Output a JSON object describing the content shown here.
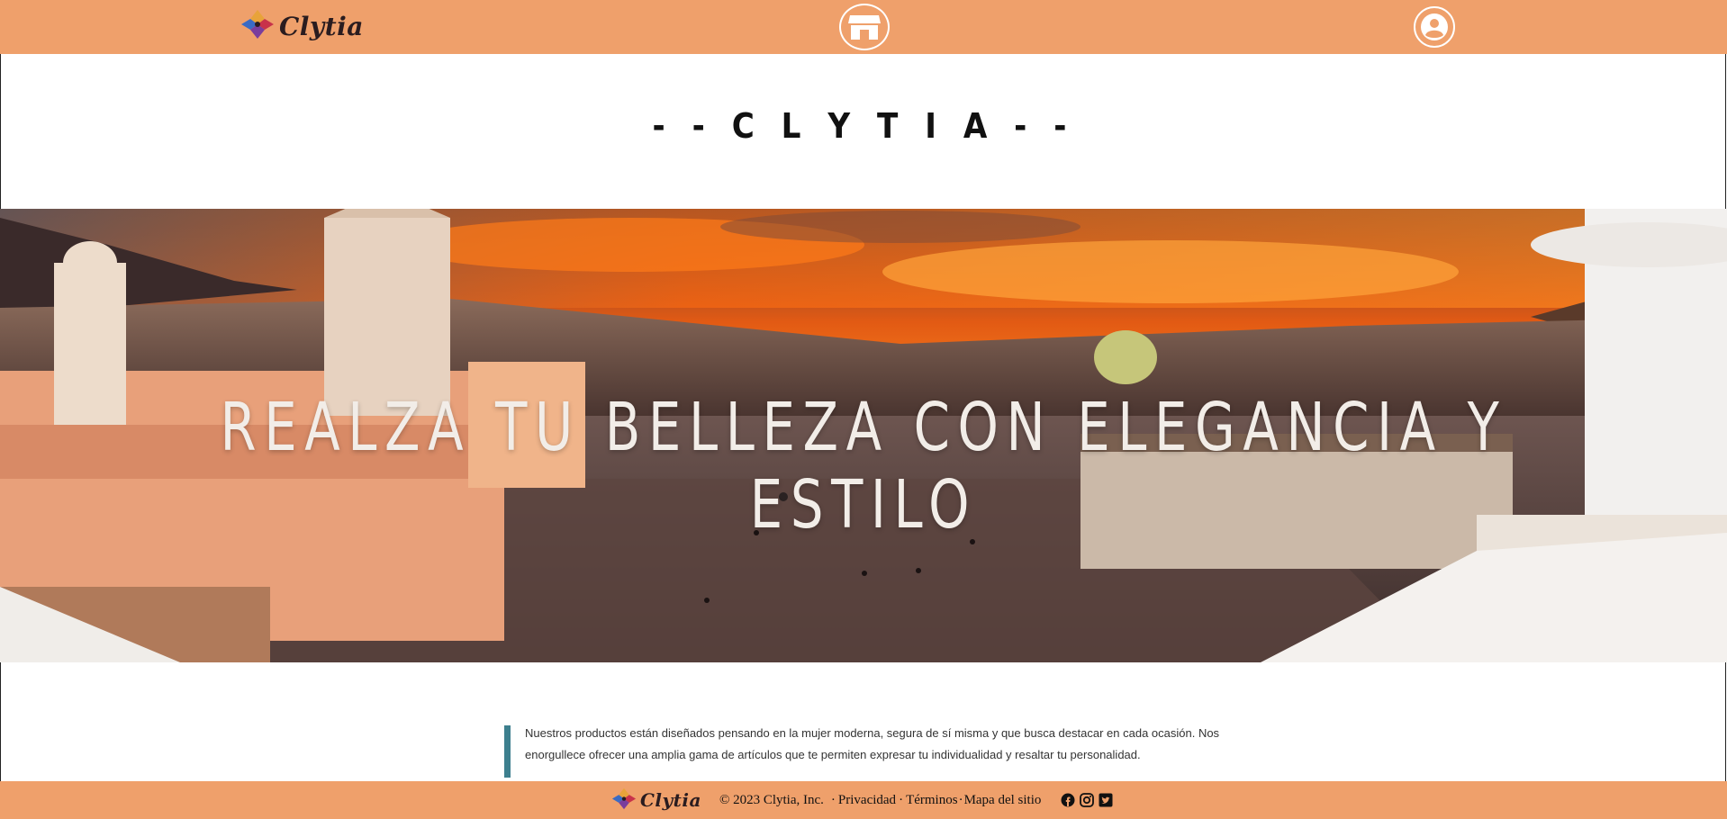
{
  "header": {
    "logo_text": "Clytia",
    "store_icon": "store-icon",
    "user_icon": "user-circle-icon"
  },
  "main": {
    "site_title": "- - C L Y T I A - -",
    "hero_heading": "REALZA TU BELLEZA CON ELEGANCIA Y ESTILO",
    "intro_text": "Nuestros productos están diseñados pensando en la mujer moderna, segura de sí misma y que busca destacar en cada ocasión. Nos enorgullece ofrecer una amplia gama de artículos que te permiten expresar tu individualidad y resaltar tu personalidad."
  },
  "footer": {
    "logo_text": "Clytia",
    "copyright": "© 2023 Clytia, Inc.",
    "links": [
      "Privacidad",
      "Términos",
      "Mapa del sitio"
    ],
    "separator": "·",
    "social_icons": [
      "facebook-icon",
      "instagram-icon",
      "twitter-icon"
    ]
  },
  "colors": {
    "bar": "#efa06b",
    "accent": "#3d7f8e"
  }
}
